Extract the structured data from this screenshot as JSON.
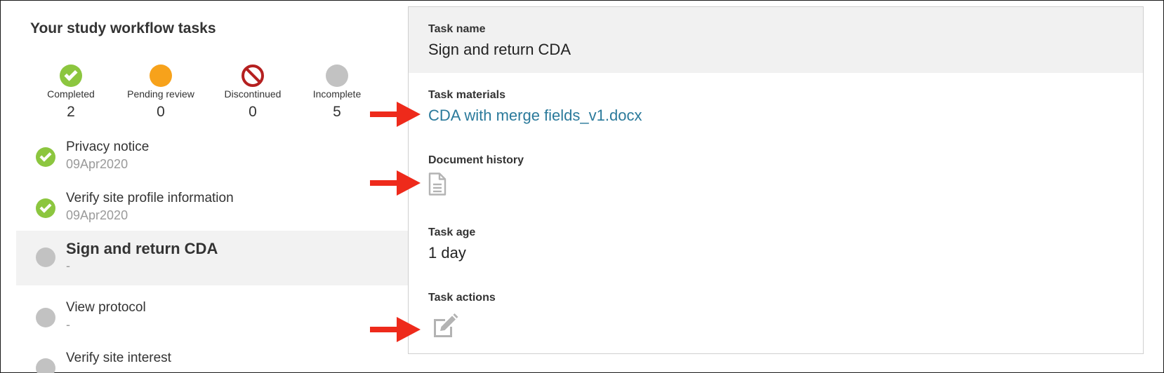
{
  "left": {
    "title": "Your study workflow tasks",
    "stats": [
      {
        "label": "Completed",
        "count": "2",
        "icon": "check-circle-icon",
        "color": "#8cc63f"
      },
      {
        "label": "Pending review",
        "count": "0",
        "icon": "orange-circle-icon",
        "color": "#f7a21b"
      },
      {
        "label": "Discontinued",
        "count": "0",
        "icon": "prohibited-icon",
        "color": "#b52020"
      },
      {
        "label": "Incomplete",
        "count": "5",
        "icon": "gray-circle-icon",
        "color": "#c2c2c2"
      }
    ],
    "tasks": [
      {
        "name": "Privacy notice",
        "date": "09Apr2020",
        "status": "completed"
      },
      {
        "name": "Verify site profile information",
        "date": "09Apr2020",
        "status": "completed"
      },
      {
        "name": "Sign and return CDA",
        "date": "-",
        "status": "incomplete",
        "selected": true
      },
      {
        "name": "View protocol",
        "date": "-",
        "status": "incomplete"
      },
      {
        "name": "Verify site interest",
        "date": "-",
        "status": "incomplete"
      }
    ]
  },
  "detail": {
    "task_name_label": "Task name",
    "task_name": "Sign and return CDA",
    "materials_label": "Task materials",
    "materials_link": "CDA with merge fields_v1.docx",
    "history_label": "Document history",
    "history_icon": "document-icon",
    "age_label": "Task age",
    "age_value": "1 day",
    "actions_label": "Task actions",
    "actions_icon": "edit-icon"
  },
  "annotations": {
    "arrow_color": "#ee2a1b"
  }
}
